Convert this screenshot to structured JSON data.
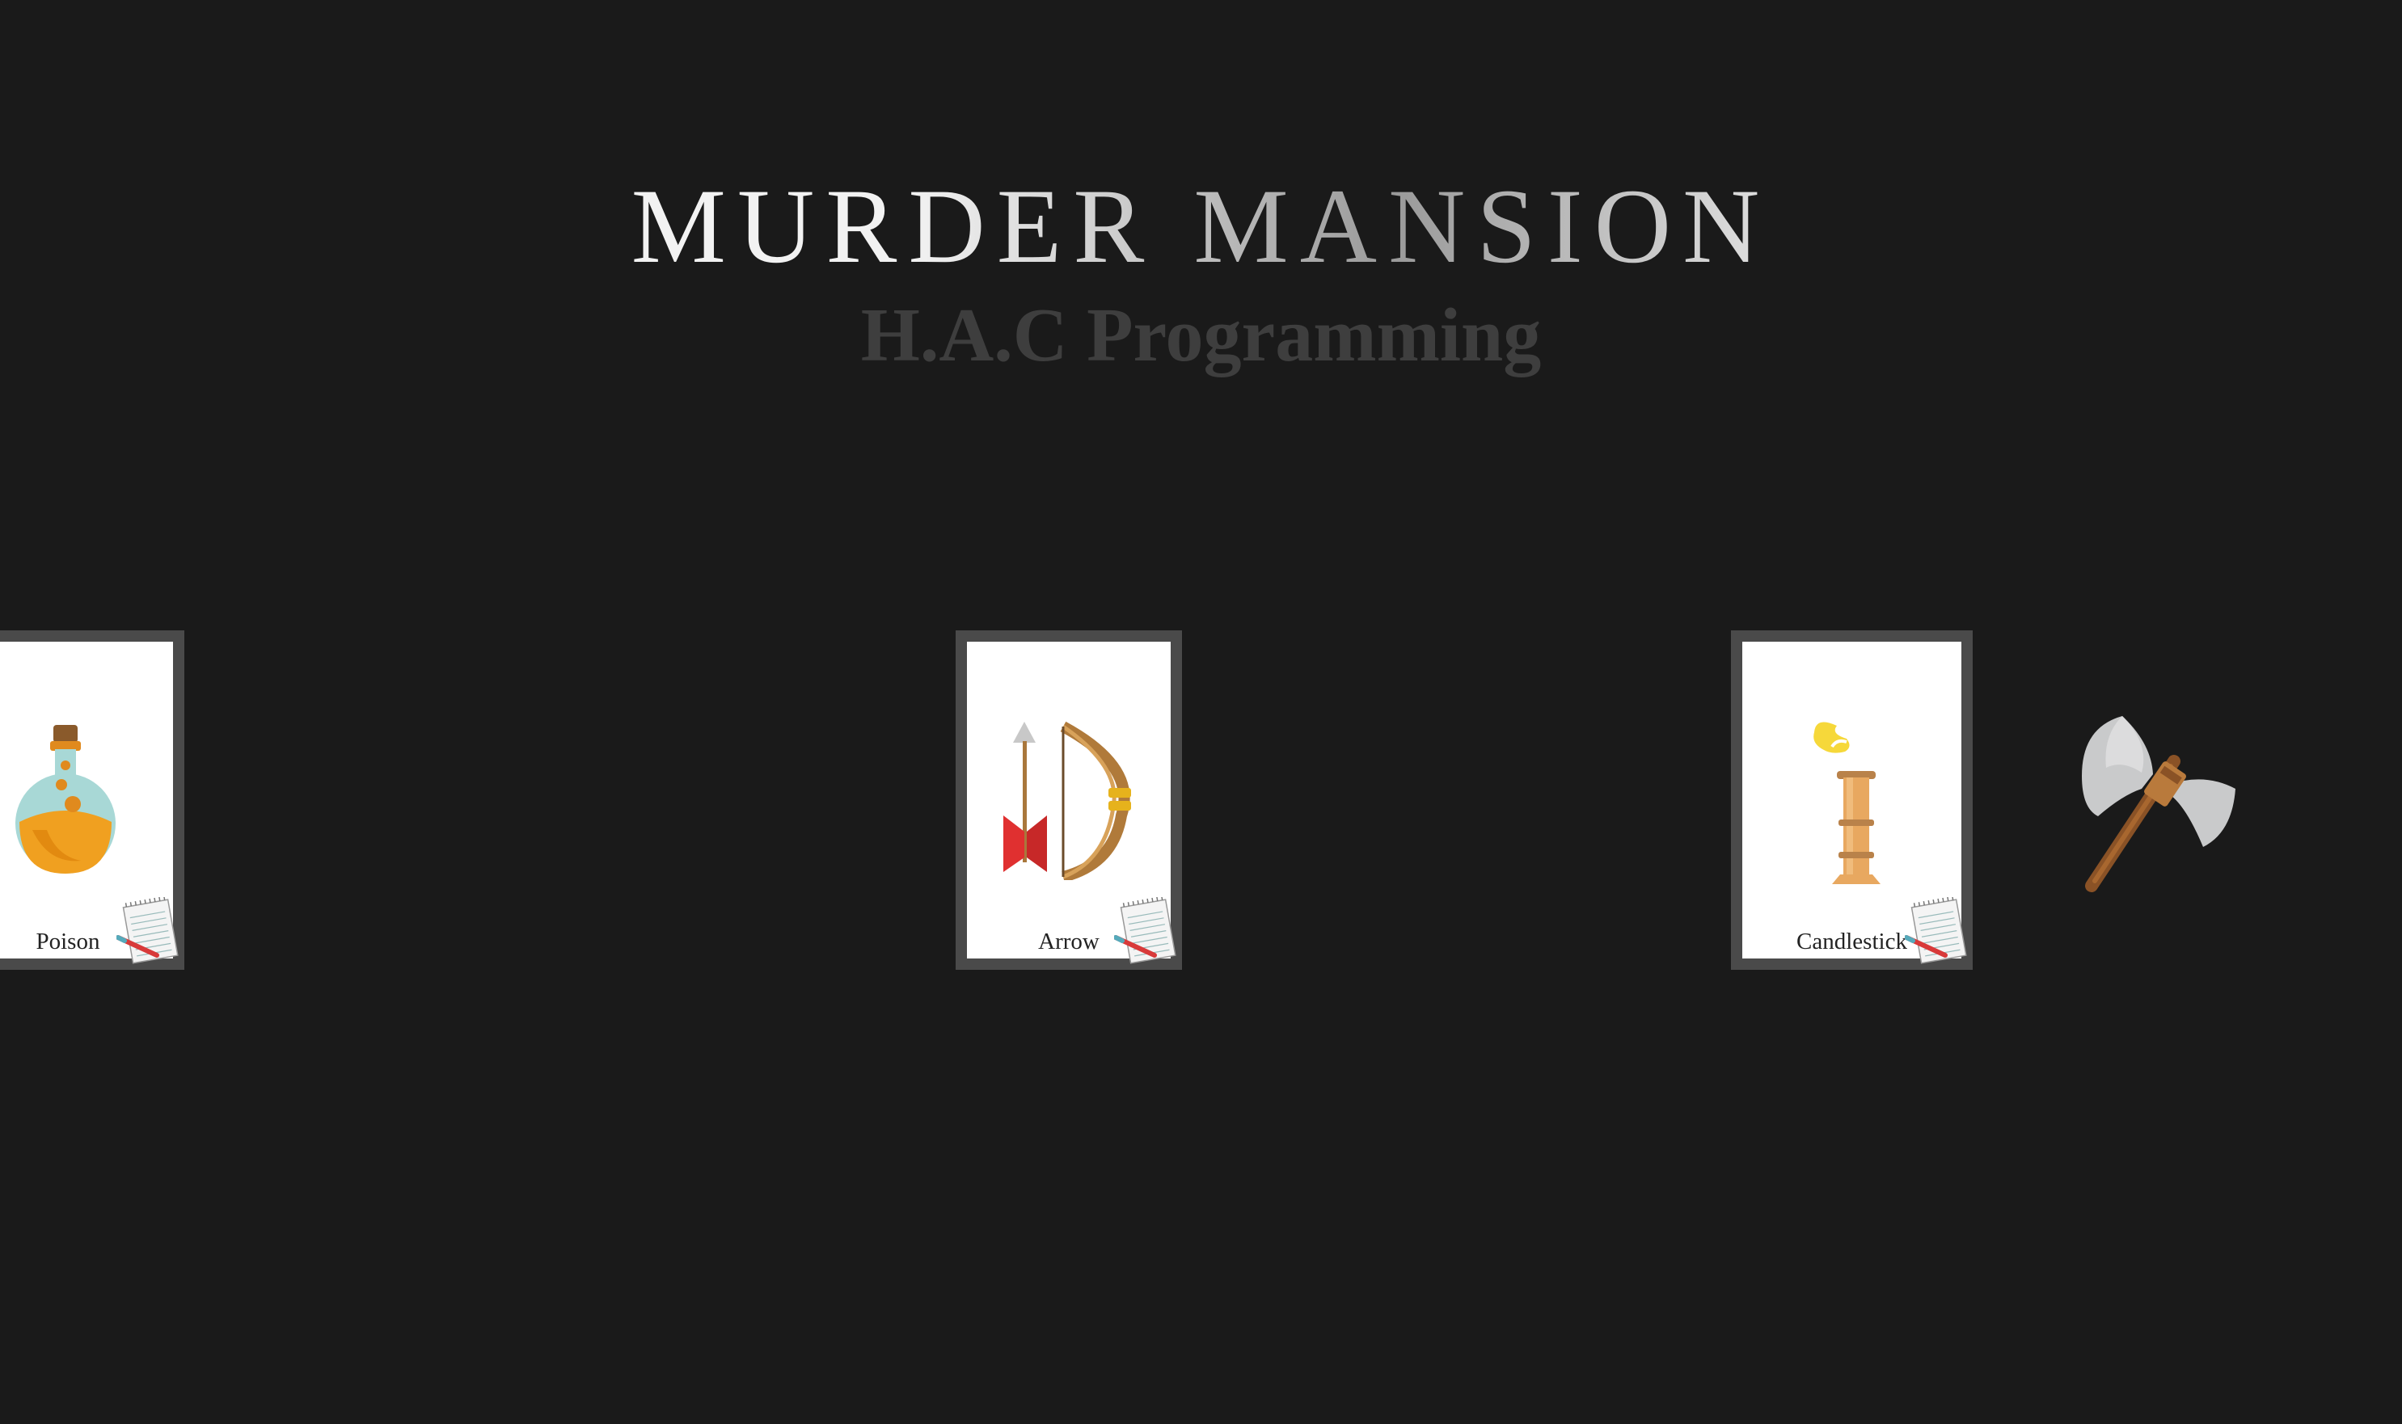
{
  "header": {
    "title": "MURDER MANSION",
    "subtitle": "H.A.C Programming"
  },
  "cards": [
    {
      "label": "Poison",
      "icon": "poison-potion-icon"
    },
    {
      "label": "Arrow",
      "icon": "bow-and-arrow-icon"
    },
    {
      "label": "Candlestick",
      "icon": "candlestick-icon"
    }
  ],
  "floating_item": {
    "icon": "battle-axe-icon"
  },
  "colors": {
    "background": "#1a1a1a",
    "card_border": "#4a4a4a",
    "card_face": "#ffffff",
    "subtitle": "#3e3e3e"
  }
}
